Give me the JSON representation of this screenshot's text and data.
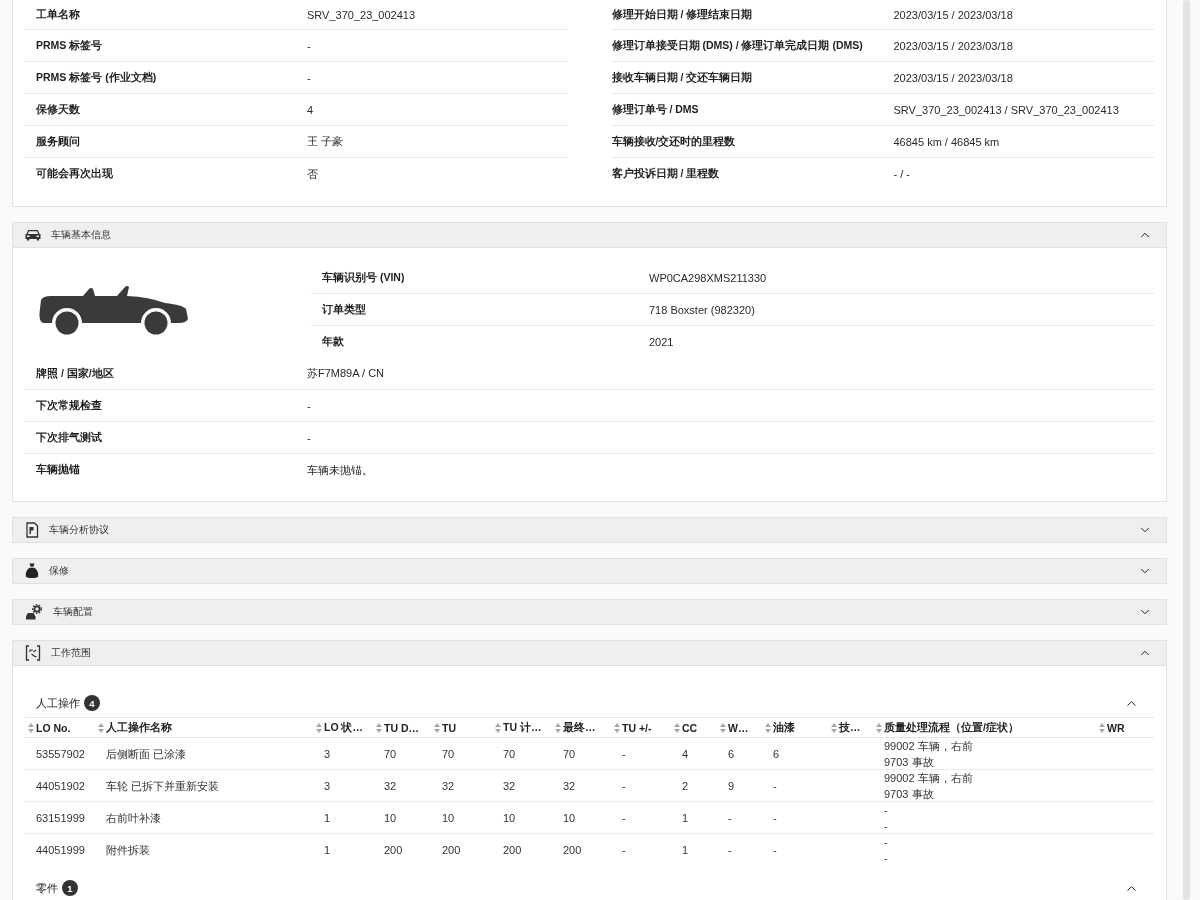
{
  "work_order": {
    "left": [
      {
        "label": "工单名称",
        "value": "SRV_370_23_002413"
      },
      {
        "label": "PRMS 标签号",
        "value": "-"
      },
      {
        "label": "PRMS 标签号 (作业文档)",
        "value": "-"
      },
      {
        "label": "保修天数",
        "value": "4"
      },
      {
        "label": "服务顾问",
        "value": "王 子豪"
      },
      {
        "label": "可能会再次出现",
        "value": "否"
      }
    ],
    "right": [
      {
        "label": "修理开始日期 / 修理结束日期",
        "value": "2023/03/15 / 2023/03/18"
      },
      {
        "label": "修理订单接受日期 (DMS) / 修理订单完成日期 (DMS)",
        "value": "2023/03/15 / 2023/03/18"
      },
      {
        "label": "接收车辆日期 / 交还车辆日期",
        "value": "2023/03/15 / 2023/03/18"
      },
      {
        "label": "修理订单号 / DMS",
        "value": "SRV_370_23_002413 / SRV_370_23_002413"
      },
      {
        "label": "车辆接收/交还时的里程数",
        "value": "46845 km / 46845 km"
      },
      {
        "label": "客户投诉日期 / 里程数",
        "value": "- / -"
      }
    ]
  },
  "sections": [
    {
      "kind": "vehicle",
      "title": "车辆基本信息",
      "expanded": true,
      "identity": [
        {
          "label": "车辆识别号 (VIN)",
          "value": "WP0CA298XMS211330"
        },
        {
          "label": "订单类型",
          "value": "718 Boxster (982320)"
        },
        {
          "label": "年款",
          "value": "2021"
        }
      ],
      "details": [
        {
          "label": "牌照 / 国家/地区",
          "value": "苏F7M89A / CN"
        },
        {
          "label": "下次常规检查",
          "value": "-"
        },
        {
          "label": "下次排气测试",
          "value": "-"
        },
        {
          "label": "车辆抛锚",
          "value": "车辆未抛锚。"
        }
      ]
    },
    {
      "kind": "analysis",
      "title": "车辆分析协议",
      "expanded": false
    },
    {
      "kind": "warranty",
      "title": "保修",
      "expanded": false
    },
    {
      "kind": "configuration",
      "title": "车辆配置",
      "expanded": false
    },
    {
      "kind": "work_scope",
      "title": "工作范围",
      "expanded": true,
      "groups": [
        {
          "title": "人工操作",
          "count": "4",
          "expanded": true,
          "columns": [
            "LO No.",
            "人工操作名称",
            "LO 状…",
            "TU D…",
            "TU",
            "TU 计…",
            "最终…",
            "TU +/-",
            "CC",
            "W…",
            "油漆",
            "技…",
            "质量处理流程（位置/症状）",
            "WR"
          ],
          "rows": [
            {
              "lo_no": "53557902",
              "name": "后侧断面 已涂漆",
              "lo_status": "3",
              "tu_d": "70",
              "tu": "70",
              "tu_calc": "70",
              "final_tu": "70",
              "tu_diff": "-",
              "cc": "4",
              "w": "6",
              "paint": "6",
              "quality": [
                "99002 车辆，右前",
                "9703 事故"
              ]
            },
            {
              "lo_no": "44051902",
              "name": "车轮 已拆下并重新安装",
              "lo_status": "3",
              "tu_d": "32",
              "tu": "32",
              "tu_calc": "32",
              "final_tu": "32",
              "tu_diff": "-",
              "cc": "2",
              "w": "9",
              "paint": "-",
              "quality": [
                "99002 车辆，右前",
                "9703 事故"
              ]
            },
            {
              "lo_no": "63151999",
              "name": "右前叶补漆",
              "lo_status": "1",
              "tu_d": "10",
              "tu": "10",
              "tu_calc": "10",
              "final_tu": "10",
              "tu_diff": "-",
              "cc": "1",
              "w": "-",
              "paint": "-",
              "quality": [
                "-",
                "-"
              ]
            },
            {
              "lo_no": "44051999",
              "name": "附件拆装",
              "lo_status": "1",
              "tu_d": "200",
              "tu": "200",
              "tu_calc": "200",
              "final_tu": "200",
              "tu_diff": "-",
              "cc": "1",
              "w": "-",
              "paint": "-",
              "quality": [
                "-",
                "-"
              ]
            }
          ]
        },
        {
          "title": "零件",
          "count": "1",
          "expanded": true
        }
      ]
    }
  ]
}
